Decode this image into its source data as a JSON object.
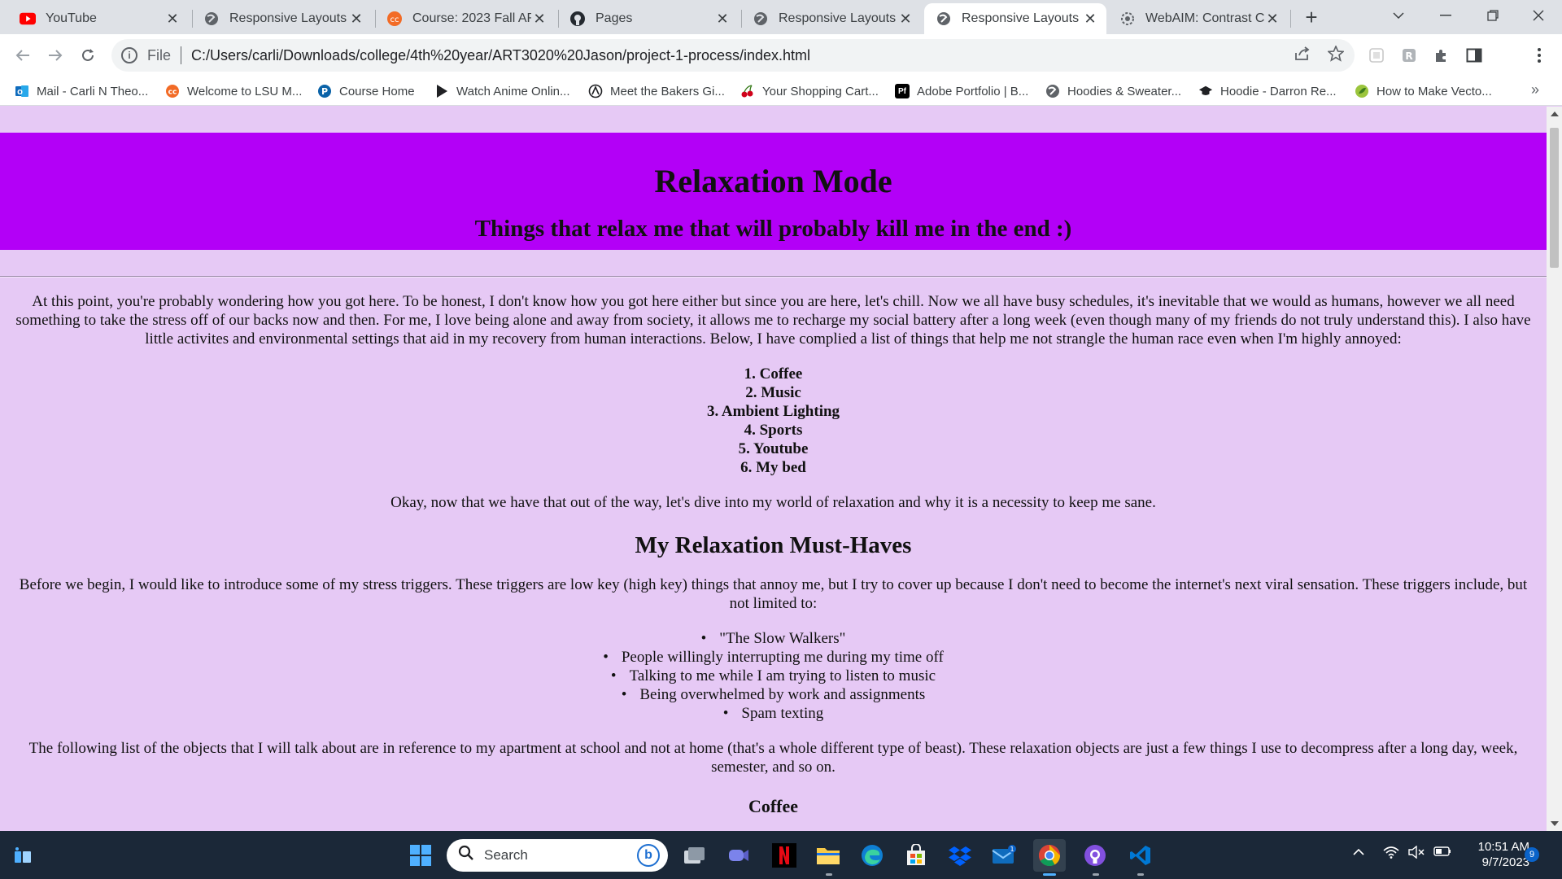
{
  "browser": {
    "tabs": [
      {
        "title": "YouTube",
        "icon": "youtube-icon",
        "active": false
      },
      {
        "title": "Responsive Layouts",
        "icon": "globe-icon",
        "active": false
      },
      {
        "title": "Course: 2023 Fall ART",
        "icon": "moodle-icon",
        "active": false
      },
      {
        "title": "Pages",
        "icon": "github-icon",
        "active": false
      },
      {
        "title": "Responsive Layouts",
        "icon": "globe-icon",
        "active": false
      },
      {
        "title": "Responsive Layouts",
        "icon": "globe-icon",
        "active": true
      },
      {
        "title": "WebAIM: Contrast Ch",
        "icon": "webaim-icon",
        "active": false
      }
    ],
    "address": {
      "scheme": "File",
      "url": "C:/Users/carli/Downloads/college/4th%20year/ART3020%20Jason/project-1-process/index.html"
    },
    "bookmarks": [
      {
        "label": "Mail - Carli N Theo...",
        "icon": "outlook-icon"
      },
      {
        "label": "Welcome to LSU M...",
        "icon": "moodle-icon"
      },
      {
        "label": "Course Home",
        "icon": "pearson-icon"
      },
      {
        "label": "Watch Anime Onlin...",
        "icon": "play-icon"
      },
      {
        "label": "Meet the Bakers Gi...",
        "icon": "bakers-icon"
      },
      {
        "label": "Your Shopping Cart...",
        "icon": "cherry-icon"
      },
      {
        "label": "Adobe Portfolio | B...",
        "icon": "adobe-portfolio-icon"
      },
      {
        "label": "Hoodies & Sweater...",
        "icon": "globe-icon"
      },
      {
        "label": "Hoodie - Darron Re...",
        "icon": "graduation-cap-icon"
      },
      {
        "label": "How to Make Vecto...",
        "icon": "leaf-icon"
      }
    ],
    "bookmarks_more": "»",
    "adobe_portfolio_glyph": "Pf"
  },
  "page": {
    "title": "Relaxation Mode",
    "subtitle": "Things that relax me that will probably kill me in the end :)",
    "intro": "At this point, you're probably wondering how you got here. To be honest, I don't know how you got here either but since you are here, let's chill. Now we all have busy schedules, it's inevitable that we would as humans, however we all need something to take the stress off of our backs now and then. For me, I love being alone and away from society, it allows me to recharge my social battery after a long week (even though many of my friends do not truly understand this). I also have little activites and environmental settings that aid in my recovery from human interactions. Below, I have complied a list of things that help me not strangle the human race even when I'm highly annoyed:",
    "relax_list": [
      "1. Coffee",
      "2. Music",
      "3. Ambient Lighting",
      "4. Sports",
      "5. Youtube",
      "6. My bed"
    ],
    "transition": "Okay, now that we have that out of the way, let's dive into my world of relaxation and why it is a necessity to keep me sane.",
    "section_heading": "My Relaxation Must-Haves",
    "triggers_intro": "Before we begin, I would like to introduce some of my stress triggers. These triggers are low key (high key) things that annoy me, but I try to cover up because I don't need to become the internet's next viral sensation. These triggers include, but not limited to:",
    "triggers": [
      "\"The Slow Walkers\"",
      "People willingly interrupting me during my time off",
      "Talking to me while I am trying to listen to music",
      "Being overwhelmed by work and assignments",
      "Spam texting"
    ],
    "objects_intro": "The following list of the objects that I will talk about are in reference to my apartment at school and not at home (that's a whole different type of beast). These relaxation objects are just a few things I use to decompress after a long day, week, semester, and so on.",
    "first_subheading": "Coffee"
  },
  "taskbar": {
    "search_placeholder": "Search",
    "bing_label": "b",
    "apps": [
      "task-view-icon",
      "teams-icon",
      "netflix-icon",
      "file-explorer-icon",
      "edge-icon",
      "store-icon",
      "dropbox-icon",
      "mail-icon",
      "chrome-icon",
      "github-desktop-icon",
      "vscode-icon"
    ],
    "mail_badge": "1",
    "time": "10:51 AM",
    "date": "9/7/2023",
    "notification_count": "9"
  },
  "colors": {
    "page_background": "#e6c9f5",
    "hero_background": "#b300f7",
    "taskbar": "#1b2838"
  }
}
